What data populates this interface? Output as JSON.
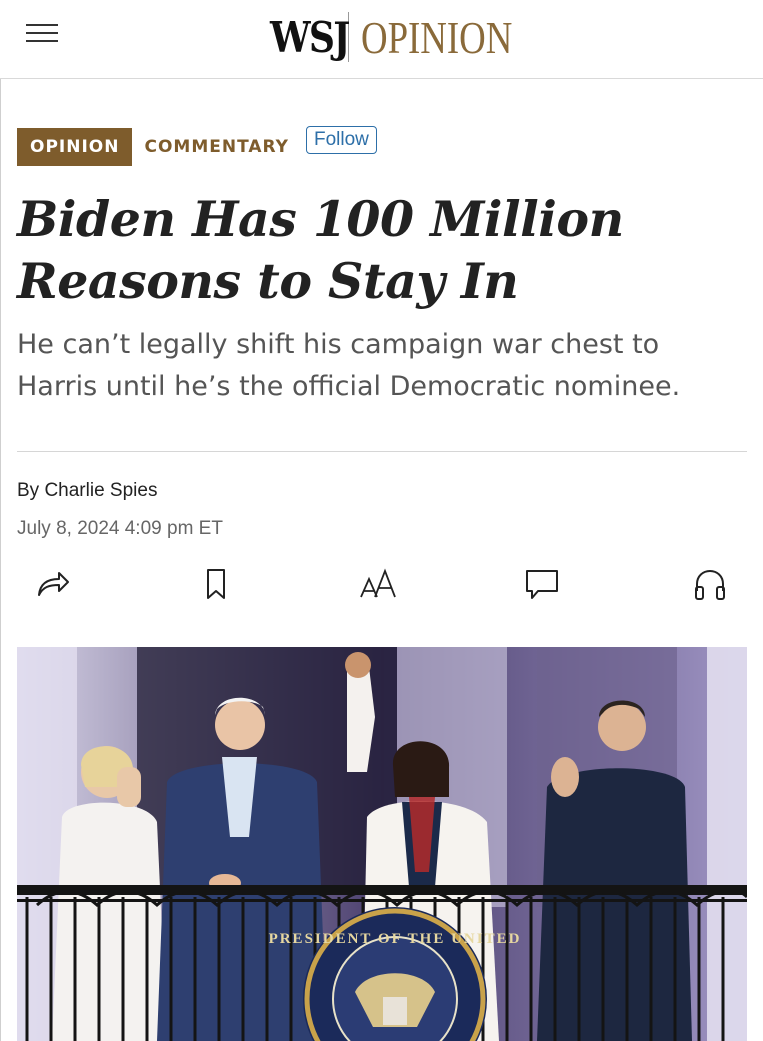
{
  "header": {
    "menu_icon": "hamburger-menu-icon",
    "logo_wsj": "WSJ",
    "logo_section": "OPINION"
  },
  "tags": {
    "section_badge": "OPINION",
    "category": "COMMENTARY",
    "follow_label": "Follow"
  },
  "article": {
    "headline": "Biden Has 100 Million Reasons to Stay In",
    "dek": "He can’t legally shift his campaign war chest to Harris until he’s the official Democratic nominee.",
    "byline_prefix": "By ",
    "author": "Charlie Spies",
    "timestamp": "July 8, 2024 4:09 pm ET"
  },
  "actions": [
    {
      "name": "share",
      "icon": "share-arrow-icon"
    },
    {
      "name": "bookmark",
      "icon": "bookmark-icon"
    },
    {
      "name": "text-size",
      "icon": "text-size-icon"
    },
    {
      "name": "comments",
      "icon": "comment-bubble-icon"
    },
    {
      "name": "listen",
      "icon": "headphones-icon"
    }
  ],
  "photo": {
    "seal_text": "PRESIDENT OF THE UNITED"
  },
  "colors": {
    "brand_brown": "#7e5c2c",
    "logo_gold": "#8a6a3a",
    "follow_blue": "#2d6fa8"
  }
}
